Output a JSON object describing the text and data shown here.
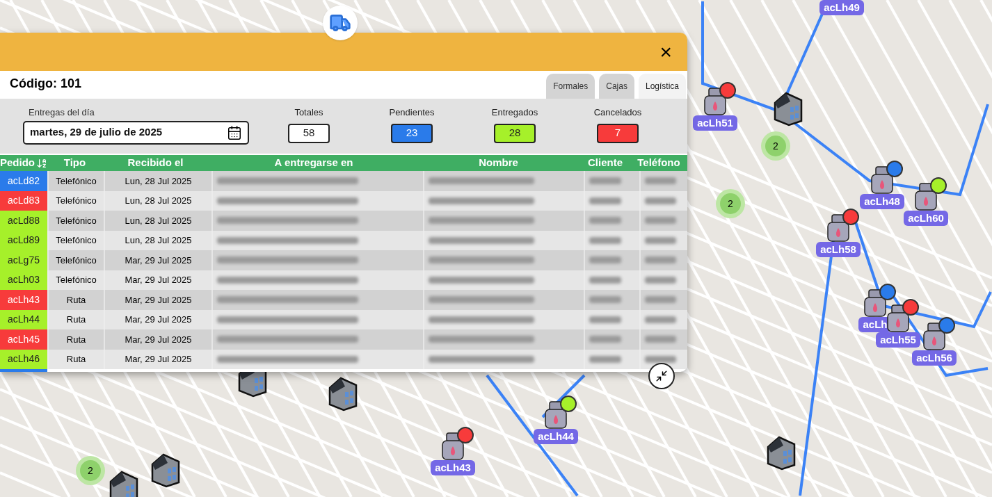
{
  "modal": {
    "title_code": "Código: 101",
    "close": "×",
    "tabs": [
      {
        "label": "Formales",
        "selected": false
      },
      {
        "label": "Cajas",
        "selected": false
      },
      {
        "label": "Logística",
        "selected": true
      }
    ],
    "date_field": {
      "label": "Entregas del día",
      "value": "martes, 29 de julio de 2025"
    },
    "counters": [
      {
        "label": "Totales",
        "value": "58",
        "color": "#ffffff"
      },
      {
        "label": "Pendientes",
        "value": "23",
        "color": "#2a7bea"
      },
      {
        "label": "Entregados",
        "value": "28",
        "color": "#a6f02a"
      },
      {
        "label": "Cancelados",
        "value": "7",
        "color": "#f73b3b"
      }
    ],
    "table": {
      "columns": [
        {
          "label": "Pedido",
          "sorted": true
        },
        {
          "label": "Tipo",
          "sorted": false
        },
        {
          "label": "Recibido el",
          "sorted": false
        },
        {
          "label": "A entregarse en",
          "sorted": false
        },
        {
          "label": "Nombre",
          "sorted": false
        },
        {
          "label": "Cliente",
          "sorted": false
        },
        {
          "label": "Teléfono",
          "sorted": false
        }
      ],
      "rows": [
        {
          "pedido": "acLd82",
          "color": "#2a7bea",
          "tipo": "Telefónico",
          "recibido": "Lun, 28 Jul 2025"
        },
        {
          "pedido": "acLd83",
          "color": "#f73b3b",
          "tipo": "Telefónico",
          "recibido": "Lun, 28 Jul 2025"
        },
        {
          "pedido": "acLd88",
          "color": "#a6f02a",
          "tipo": "Telefónico",
          "recibido": "Lun, 28 Jul 2025"
        },
        {
          "pedido": "acLd89",
          "color": "#a6f02a",
          "tipo": "Telefónico",
          "recibido": "Lun, 28 Jul 2025"
        },
        {
          "pedido": "acLg75",
          "color": "#a6f02a",
          "tipo": "Telefónico",
          "recibido": "Mar, 29 Jul 2025"
        },
        {
          "pedido": "acLh03",
          "color": "#a6f02a",
          "tipo": "Telefónico",
          "recibido": "Mar, 29 Jul 2025"
        },
        {
          "pedido": "acLh43",
          "color": "#f73b3b",
          "tipo": "Ruta",
          "recibido": "Mar, 29 Jul 2025"
        },
        {
          "pedido": "acLh44",
          "color": "#a6f02a",
          "tipo": "Ruta",
          "recibido": "Mar, 29 Jul 2025"
        },
        {
          "pedido": "acLh45",
          "color": "#f73b3b",
          "tipo": "Ruta",
          "recibido": "Mar, 29 Jul 2025"
        },
        {
          "pedido": "acLh46",
          "color": "#a6f02a",
          "tipo": "Ruta",
          "recibido": "Mar, 29 Jul 2025"
        }
      ]
    }
  },
  "map": {
    "markers": [
      {
        "label": "acLh49"
      },
      {
        "label": "acLh51",
        "color": "#f73b3b"
      },
      {
        "label": "acLh48",
        "color": "#2a7bea"
      },
      {
        "label": "acLh60",
        "color": "#a6f02a"
      },
      {
        "label": "acLh58",
        "color": "#f73b3b"
      },
      {
        "label": "acLh",
        "color": "#2a7bea"
      },
      {
        "label": "acLh55",
        "color": "#f73b3b"
      },
      {
        "label": "acLh56",
        "color": "#2a7bea"
      },
      {
        "label": "acLh44",
        "color": "#a6f02a"
      },
      {
        "label": "acLh43",
        "color": "#f73b3b"
      }
    ],
    "clusters": [
      {
        "count": "2"
      },
      {
        "count": "2"
      },
      {
        "count": "2"
      }
    ]
  }
}
